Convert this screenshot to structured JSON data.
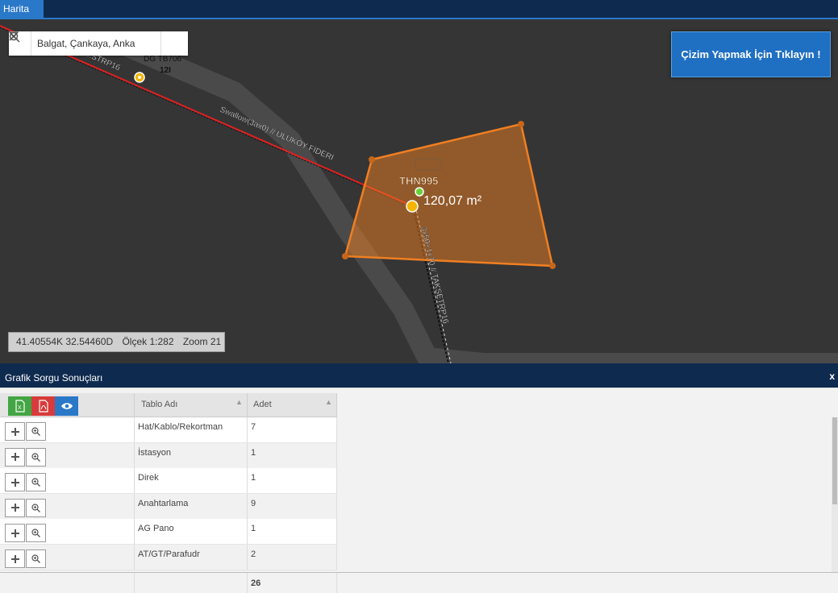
{
  "tab": {
    "label": "Harita"
  },
  "search": {
    "value": "Balgat, Çankaya, Anka"
  },
  "map": {
    "draw_button": "Çizim Yapmak İçin Tıklayın !",
    "area_label": "120,07 m²",
    "feature_label": "THN995",
    "feature_label_2": "DG TB706",
    "feature_label_3": "12I",
    "line_label_1": "Swallow(3ax0) // ULUKÖY FİDERİ",
    "line_label_2": "3x50+1x70 // TAKSETRP16",
    "line_label_3": "...STRP16"
  },
  "status": {
    "coords": "41.40554K 32.54460D",
    "scale": "Ölçek 1:282",
    "zoom": "Zoom 21"
  },
  "panel": {
    "title": "Grafik Sorgu Sonuçları",
    "close": "x",
    "columns": {
      "name": "Tablo Adı",
      "count": "Adet"
    },
    "rows": [
      {
        "name": "Hat/Kablo/Rekortman",
        "count": "7"
      },
      {
        "name": "İstasyon",
        "count": "1"
      },
      {
        "name": "Direk",
        "count": "1"
      },
      {
        "name": "Anahtarlama",
        "count": "9"
      },
      {
        "name": "AG Pano",
        "count": "1"
      },
      {
        "name": "AT/GT/Parafudr",
        "count": "2"
      }
    ],
    "total": "26"
  },
  "colors": {
    "accent": "#2a78c8",
    "header": "#0f2a4f",
    "polygon": "#f07f22",
    "map": "#353535"
  }
}
